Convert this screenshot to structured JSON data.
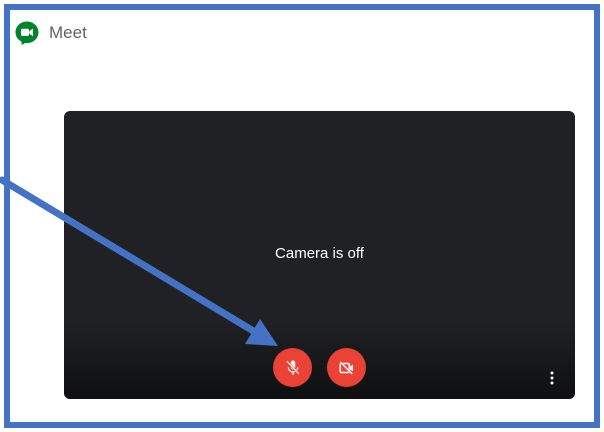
{
  "app": {
    "title": "Meet",
    "logo_icon": "google-meet-logo-icon"
  },
  "preview": {
    "status_text": "Camera is off",
    "controls": {
      "mic": {
        "icon": "mic-off-icon",
        "state": "off",
        "color": "#ea4335"
      },
      "camera": {
        "icon": "videocam-off-icon",
        "state": "off",
        "color": "#ea4335"
      },
      "more": {
        "icon": "more-vert-icon"
      }
    }
  },
  "annotation": {
    "type": "arrow",
    "color": "#4472c4",
    "points_to": "mic-off-button"
  },
  "colors": {
    "frame_border": "#4472c4",
    "preview_background": "#202124",
    "control_red": "#ea4335"
  }
}
